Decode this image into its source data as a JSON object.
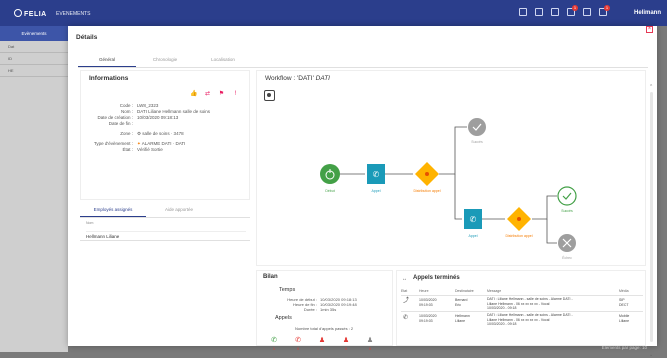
{
  "topbar": {
    "logo": "FELIA",
    "app_name": "EVENEMENTS",
    "user": "Helimann",
    "badges": [
      "1",
      "1"
    ]
  },
  "background": {
    "tab_label": "Evènements",
    "rows": [
      "Dat",
      "ID",
      "HE"
    ],
    "footer": "Elements par page: 10"
  },
  "modal": {
    "title": "Détails",
    "tabs": [
      "Général",
      "Chronologie",
      "Localisation"
    ]
  },
  "info": {
    "title": "Informations",
    "fields": [
      {
        "label": "Code :",
        "value": "LW8_2323"
      },
      {
        "label": "Nom :",
        "value": "DATI Liliane Hellmann salle de soins"
      },
      {
        "label": "Date de création :",
        "value": "10/03/2020 09:18:13"
      },
      {
        "label": "Date de fin :",
        "value": ""
      },
      {
        "label": "Zone :",
        "value": "salle de soins · 3478"
      },
      {
        "label": "Type d'évènement :",
        "value": "ALARME DATI · DATI"
      },
      {
        "label": "État :",
        "value": "Vérifié Sortie"
      }
    ],
    "subtabs": [
      "Employés assignés",
      "Aide apportée"
    ],
    "agent_header": "Nom",
    "agent_name": "Hellmann Liliane"
  },
  "workflow": {
    "title": "Workflow : 'DATI' ",
    "title_em": "DATI",
    "nodes": {
      "start": "Début",
      "call1": "Appel",
      "dispatch1": "Distribution appel",
      "success_top": "Succès",
      "call2": "Appel",
      "dispatch2": "Distribution appel",
      "success": "Succès",
      "failure": "Échec"
    },
    "colors": {
      "start": "#43a047",
      "call": "#1a9ab8",
      "dispatch": "#ffb300",
      "ok": "#43a047",
      "fail": "#9e9e9e"
    }
  },
  "bilan": {
    "title": "Bilan",
    "temps_title": "Temps",
    "rows": [
      {
        "label": "Heure de début :",
        "value": "10/03/2020 09:18:13"
      },
      {
        "label": "Heure de fin :",
        "value": "10/03/2020 09:19:48"
      },
      {
        "label": "Durée :",
        "value": "1min 35s"
      }
    ],
    "appels_title": "Appels",
    "total_label": "Nombre total d'appels passés : 2",
    "counts": [
      "1",
      "0",
      "1",
      "0",
      "0"
    ]
  },
  "appels": {
    "title": "Appels terminés",
    "headers": [
      "Etat",
      "Heure",
      "Destinataire",
      "Message",
      "Média"
    ],
    "rows": [
      {
        "time": "10/03/2020\n09:19:03",
        "dest": "Bernard\nEric",
        "message": "DATI : Liliane Hellmann - salle de soins - Alarme DATI -\nLiliane Hellmann - 06 xx xx xx xx - Vocal\n10/03/2020 - 09:18",
        "media": "SIP\nDECT"
      },
      {
        "time": "10/03/2020\n09:19:03",
        "dest": "Hellmann\nLiliane",
        "message": "DATI : Liliane Hellmann - salle de soins - Alarme DATI -\nLiliane Hellmann - 06 xx xx xx xx - Vocal\n10/03/2020 - 09:18",
        "media": "Mobile\nLiliane"
      }
    ]
  }
}
